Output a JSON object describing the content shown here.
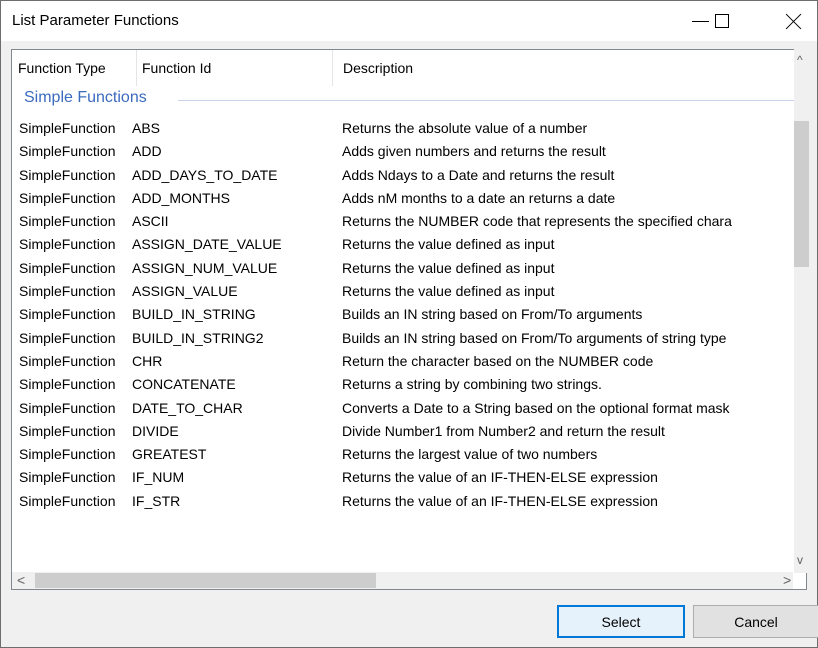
{
  "window": {
    "title": "List Parameter Functions"
  },
  "columns": [
    "Function Type",
    "Function Id",
    "Description"
  ],
  "group": "Simple Functions",
  "rows": [
    [
      "SimpleFunction",
      "ABS",
      "Returns the absolute value of a number"
    ],
    [
      "SimpleFunction",
      "ADD",
      "Adds given numbers and returns the result"
    ],
    [
      "SimpleFunction",
      "ADD_DAYS_TO_DATE",
      "Adds Ndays to a Date and returns the result"
    ],
    [
      "SimpleFunction",
      "ADD_MONTHS",
      "Adds nM months to a date an returns a date"
    ],
    [
      "SimpleFunction",
      "ASCII",
      "Returns the NUMBER code that represents the specified chara"
    ],
    [
      "SimpleFunction",
      "ASSIGN_DATE_VALUE",
      "Returns the value defined as input"
    ],
    [
      "SimpleFunction",
      "ASSIGN_NUM_VALUE",
      "Returns the value defined as input"
    ],
    [
      "SimpleFunction",
      "ASSIGN_VALUE",
      "Returns the value defined as input"
    ],
    [
      "SimpleFunction",
      "BUILD_IN_STRING",
      "Builds an IN string based on From/To arguments"
    ],
    [
      "SimpleFunction",
      "BUILD_IN_STRING2",
      "Builds an IN string based on From/To arguments of string type"
    ],
    [
      "SimpleFunction",
      "CHR",
      "Return the character based on the NUMBER code"
    ],
    [
      "SimpleFunction",
      "CONCATENATE",
      "Returns a string by combining two strings."
    ],
    [
      "SimpleFunction",
      "DATE_TO_CHAR",
      "Converts a Date to a String based on the optional format mask"
    ],
    [
      "SimpleFunction",
      "DIVIDE",
      "Divide Number1 from Number2 and return the result"
    ],
    [
      "SimpleFunction",
      "GREATEST",
      "Returns the largest value of two numbers"
    ],
    [
      "SimpleFunction",
      "IF_NUM",
      "Returns the value of an IF-THEN-ELSE expression"
    ],
    [
      "SimpleFunction",
      "IF_STR",
      "Returns the value of an IF-THEN-ELSE expression"
    ]
  ],
  "buttons": {
    "select": "Select",
    "cancel": "Cancel"
  },
  "icons": {
    "minimize": "minimize-icon",
    "maximize": "maximize-icon",
    "close": "close-icon"
  },
  "colors": {
    "group_label": "#3a6bbf",
    "select_border": "#0078d7"
  }
}
